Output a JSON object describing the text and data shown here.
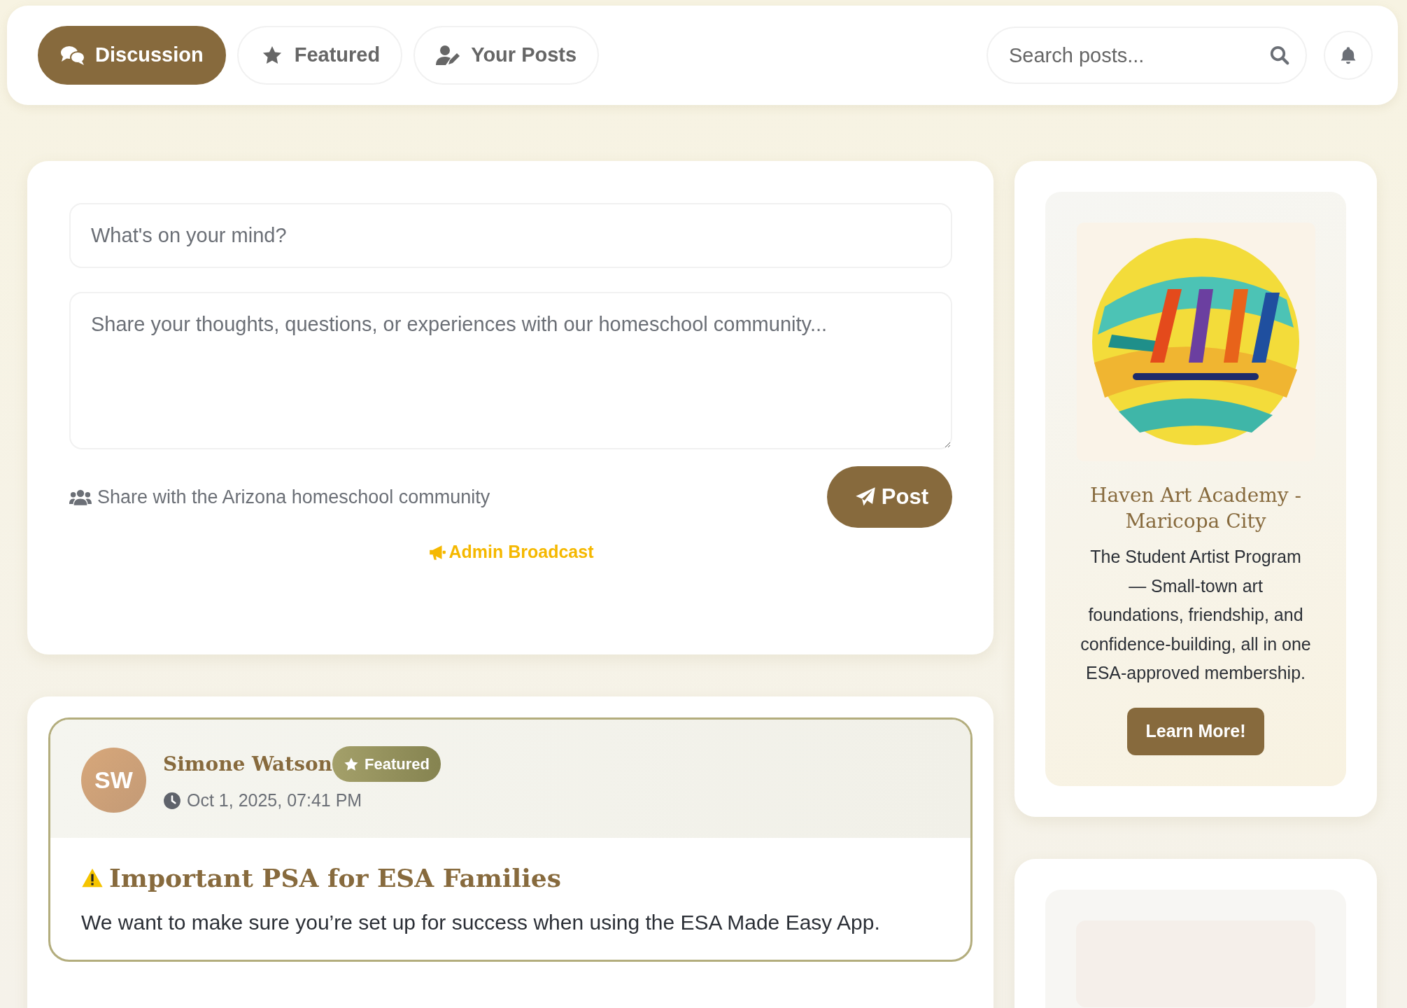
{
  "nav": {
    "tabs": [
      {
        "label": "Discussion",
        "selected": true
      },
      {
        "label": "Featured",
        "selected": false
      },
      {
        "label": "Your Posts",
        "selected": false
      }
    ],
    "search": {
      "placeholder": "Search posts..."
    }
  },
  "composer": {
    "title_placeholder": "What's on your mind?",
    "body_placeholder": "Share your thoughts, questions, or experiences with our homeschool community...",
    "share_note": "Share with the Arizona homeschool community",
    "post_button": "Post",
    "broadcast_link": "Admin Broadcast"
  },
  "posts": [
    {
      "initials": "SW",
      "author": "Simone Watson",
      "badge": "Featured",
      "time": "Oct 1, 2025, 07:41 PM",
      "title": "Important PSA for ESA Families",
      "body": "We want to make sure you’re set up for success when using the ESA Made Easy App."
    }
  ],
  "sidebar": {
    "cards": [
      {
        "kind": "promo",
        "title": "Haven Art Academy - Maricopa City",
        "text": "The Student Artist Program — Small-town art foundations, friendship, and confidence-building, all in one ESA-approved membership.",
        "button": "Learn More!"
      },
      {
        "kind": "empty"
      }
    ]
  }
}
